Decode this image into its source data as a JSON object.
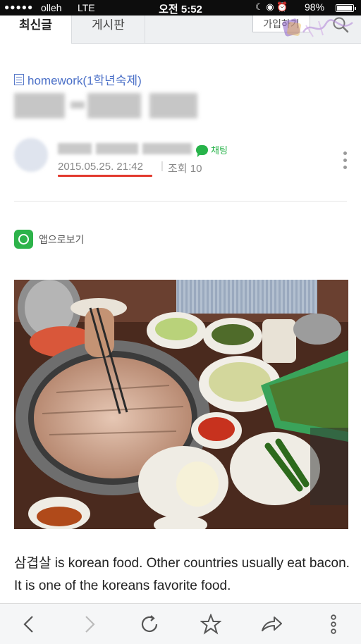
{
  "status_bar": {
    "signal": "●●●●●",
    "carrier": "olleh",
    "network": "LTE",
    "time": "오전 5:52",
    "icons": "☾ ◉ ⏰",
    "battery": "98%"
  },
  "tabs": [
    {
      "label": "최신글",
      "active": true
    },
    {
      "label": "게시판",
      "active": false
    }
  ],
  "header": {
    "join_label": "가입하기"
  },
  "post": {
    "category": "homework(1학년숙제)",
    "chat_label": "채팅",
    "date": "2015.05.25. 21:42",
    "views": "조회 10"
  },
  "app_view_label": "앱으로보기",
  "body_text": "삼겹살 is korean food. Other countries usually eat bacon. It is one of the koreans favorite food.",
  "toolbar": {
    "icons": [
      "back-icon",
      "forward-icon",
      "refresh-icon",
      "bookmark-star-icon",
      "share-icon",
      "more-icon"
    ]
  },
  "colors": {
    "accent_blue": "#4a6fc7",
    "chat_green": "#27b34a",
    "underline_red": "#e23a2e"
  }
}
